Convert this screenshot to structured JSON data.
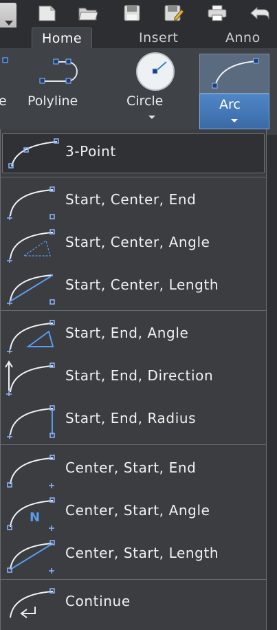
{
  "ribbon": {
    "tabs": [
      {
        "label": "Home",
        "active": true
      },
      {
        "label": "Insert",
        "active": false
      },
      {
        "label": "Anno",
        "active": false
      }
    ],
    "tools": {
      "line_partial": "e",
      "polyline": "Polyline",
      "circle": "Circle",
      "arc": "Arc"
    }
  },
  "arc_menu": {
    "groups": [
      {
        "items": [
          {
            "label": "3-Point",
            "icon": "arc-3-point-icon"
          }
        ]
      },
      {
        "items": [
          {
            "label": "Start, Center, End",
            "icon": "arc-start-center-end-icon"
          },
          {
            "label": "Start, Center, Angle",
            "icon": "arc-start-center-angle-icon"
          },
          {
            "label": "Start, Center, Length",
            "icon": "arc-start-center-length-icon"
          }
        ]
      },
      {
        "items": [
          {
            "label": "Start, End, Angle",
            "icon": "arc-start-end-angle-icon"
          },
          {
            "label": "Start, End, Direction",
            "icon": "arc-start-end-direction-icon"
          },
          {
            "label": "Start, End, Radius",
            "icon": "arc-start-end-radius-icon"
          }
        ]
      },
      {
        "items": [
          {
            "label": "Center, Start, End",
            "icon": "arc-center-start-end-icon"
          },
          {
            "label": "Center, Start, Angle",
            "icon": "arc-center-start-angle-icon"
          },
          {
            "label": "Center, Start, Length",
            "icon": "arc-center-start-length-icon"
          }
        ]
      },
      {
        "items": [
          {
            "label": "Continue",
            "icon": "arc-continue-icon"
          }
        ]
      }
    ]
  },
  "colors": {
    "accent_blue": "#4f86c6",
    "icon_blue": "#5b9cf0",
    "menu_bg": "#3b3d40"
  }
}
